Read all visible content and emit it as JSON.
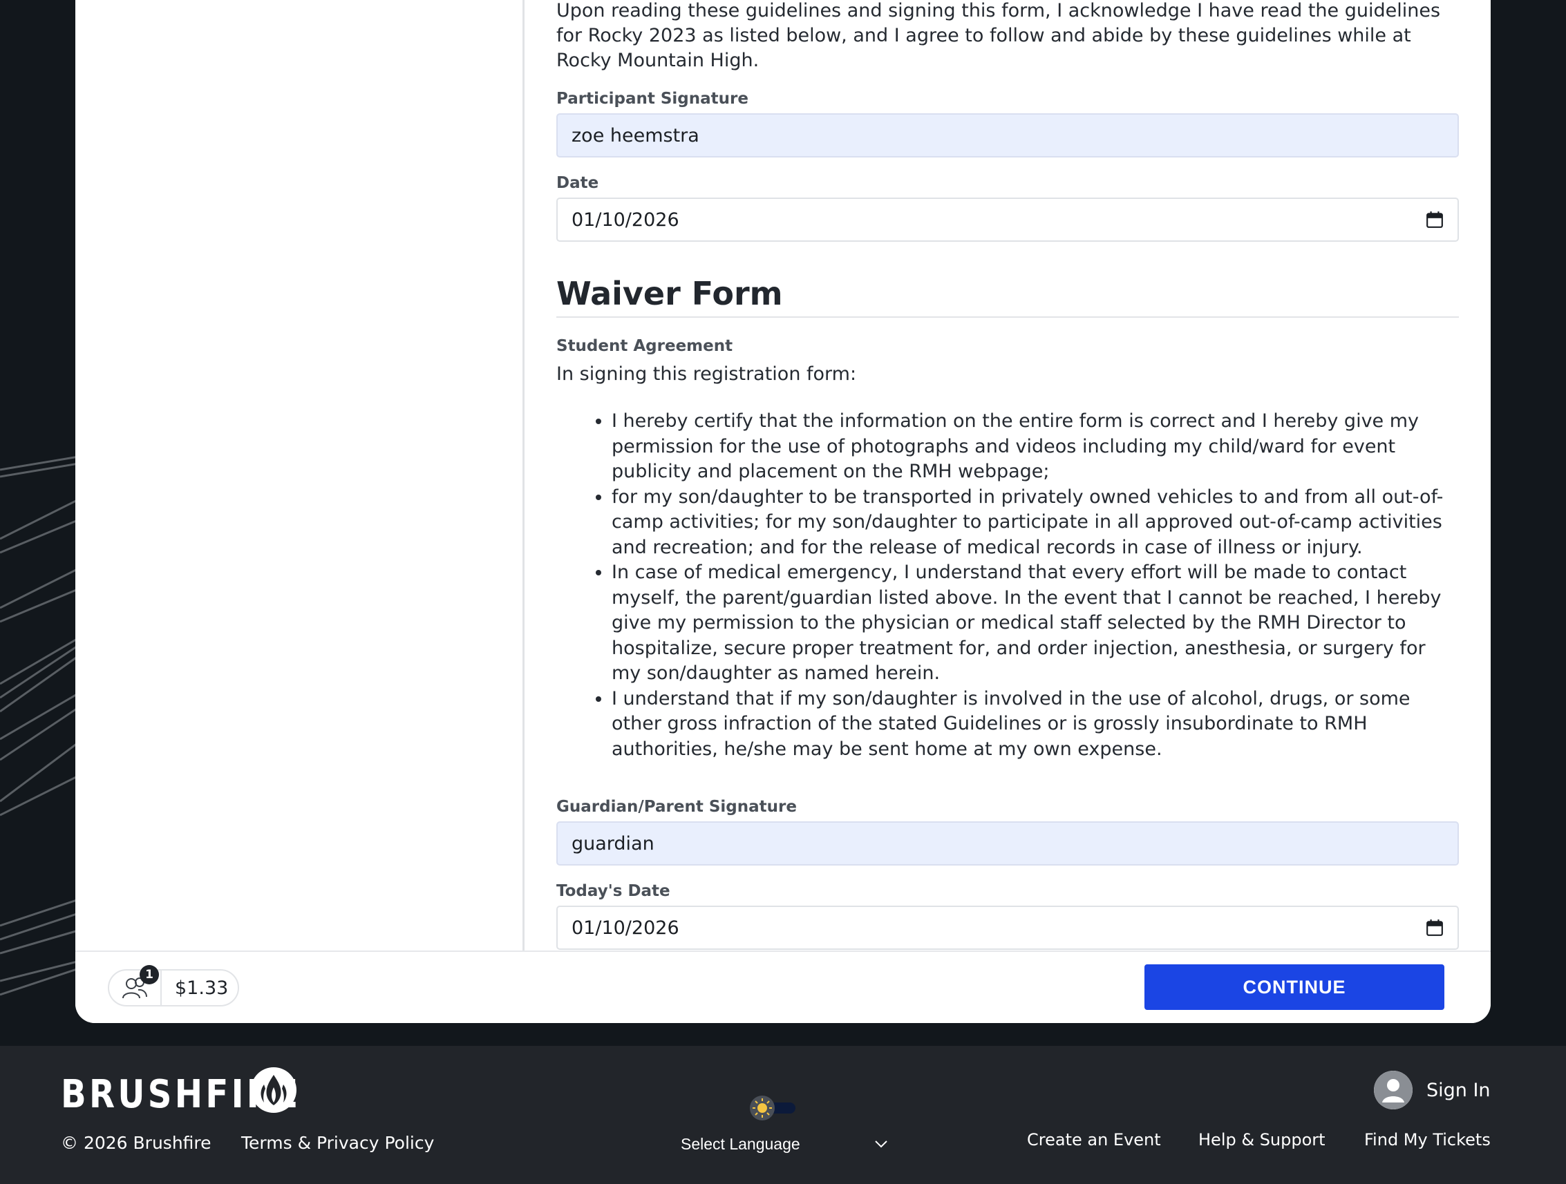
{
  "form": {
    "intro": "Upon reading these guidelines and signing this form, I acknowledge I have read the guidelines for Rocky 2023 as listed below, and I agree to follow and abide by these guidelines while at Rocky Mountain High.",
    "participant_signature_label": "Participant Signature",
    "participant_signature_value": "zoe heemstra",
    "date_label": "Date",
    "date_value": "01/10/2026",
    "waiver_title": "Waiver Form",
    "student_agreement_label": "Student Agreement",
    "registration_intro": "In signing this registration form:",
    "bullets": [
      "I hereby certify that the information on the entire form is correct and I hereby give my permission for the use of photographs and videos including my child/ward for event publicity and placement on the RMH webpage;",
      "for my son/daughter to be transported in privately owned vehicles to and from all out-of-camp activities; for my son/daughter to participate in all approved out-of-camp activities and recreation; and for the release of medical records in case of illness or injury.",
      "In case of medical emergency, I understand that every effort will be made to contact myself, the parent/guardian listed above.  In the event that I cannot be reached, I hereby give my permission to the physician or medical staff selected by the RMH Director to hospitalize, secure proper treatment for, and order injection, anesthesia, or surgery for my son/daughter as named herein.",
      "I understand that if my son/daughter is involved in the use of alcohol, drugs, or some other gross infraction of the stated Guidelines or is grossly insubordinate to RMH authorities, he/she may be sent home at my own expense."
    ],
    "guardian_signature_label": "Guardian/Parent Signature",
    "guardian_signature_value": "guardian",
    "todays_date_label": "Today's Date",
    "todays_date_value": "01/10/2026"
  },
  "cart": {
    "count": "1",
    "total": "$1.33",
    "icon": "people-icon"
  },
  "actions": {
    "continue_label": "CONTINUE"
  },
  "footer": {
    "logo_text": "BRUSHFIRE",
    "copyright": "© 2026 Brushfire",
    "terms": "Terms & Privacy Policy",
    "language": "Select Language",
    "sign_in": "Sign In",
    "links": [
      "Create an Event",
      "Help & Support",
      "Find My Tickets"
    ]
  },
  "colors": {
    "primary": "#1b45e4",
    "filled_input": "#e9effd",
    "page_bg": "#12171c",
    "footer_bg": "#22252a"
  }
}
